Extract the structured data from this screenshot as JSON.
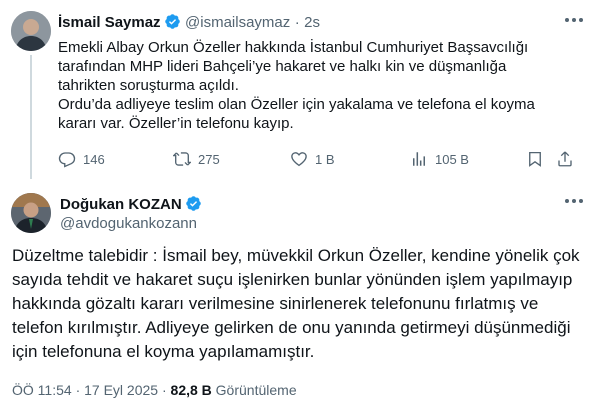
{
  "reply_tweet": {
    "author_name": "İsmail Saymaz",
    "author_handle": "@ismailsaymaz",
    "separator": "·",
    "time_ago": "2s",
    "text_lines": [
      "Emekli Albay Orkun Özeller hakkında İstanbul Cumhuriyet Başsavcılığı",
      "tarafından MHP lideri Bahçeli’ye hakaret ve halkı kin ve düşmanlığa",
      "tahrikten soruşturma açıldı.",
      "Ordu’da adliyeye teslim olan Özeller için yakalama ve telefona el koyma",
      "kararı var. Özeller’in telefonu kayıp."
    ],
    "actions": {
      "replies": "146",
      "reposts": "275",
      "likes": "1 B",
      "views": "105 B"
    }
  },
  "main_tweet": {
    "author_name": "Doğukan KOZAN",
    "author_handle": "@avdogukankozann",
    "text": "Düzeltme talebidir : İsmail bey, müvekkil Orkun Özeller, kendine yönelik çok sayıda tehdit ve hakaret suçu işlenirken bunlar yönünden işlem yapılmayıp hakkında gözaltı kararı verilmesine sinirlenerek telefonunu fırlatmış ve telefon kırılmıştır. Adliyeye gelirken de onu yanında getirmeyi düşünmediği için telefonuna el koyma yapılamamıştır.",
    "time": "ÖÖ 11:54",
    "separator": "·",
    "date": "17 Eyl 2025",
    "view_count": "82,8 B",
    "view_label": "Görüntüleme"
  },
  "icons": {
    "verified_badge": "verified-badge-icon",
    "more": "more-icon",
    "reply": "reply-icon",
    "repost": "repost-icon",
    "like": "like-icon",
    "views": "views-icon",
    "bookmark": "bookmark-icon",
    "share": "share-icon"
  },
  "colors": {
    "verified_blue": "#1d9bf0",
    "secondary_text": "#536471",
    "primary_text": "#0f1419"
  }
}
